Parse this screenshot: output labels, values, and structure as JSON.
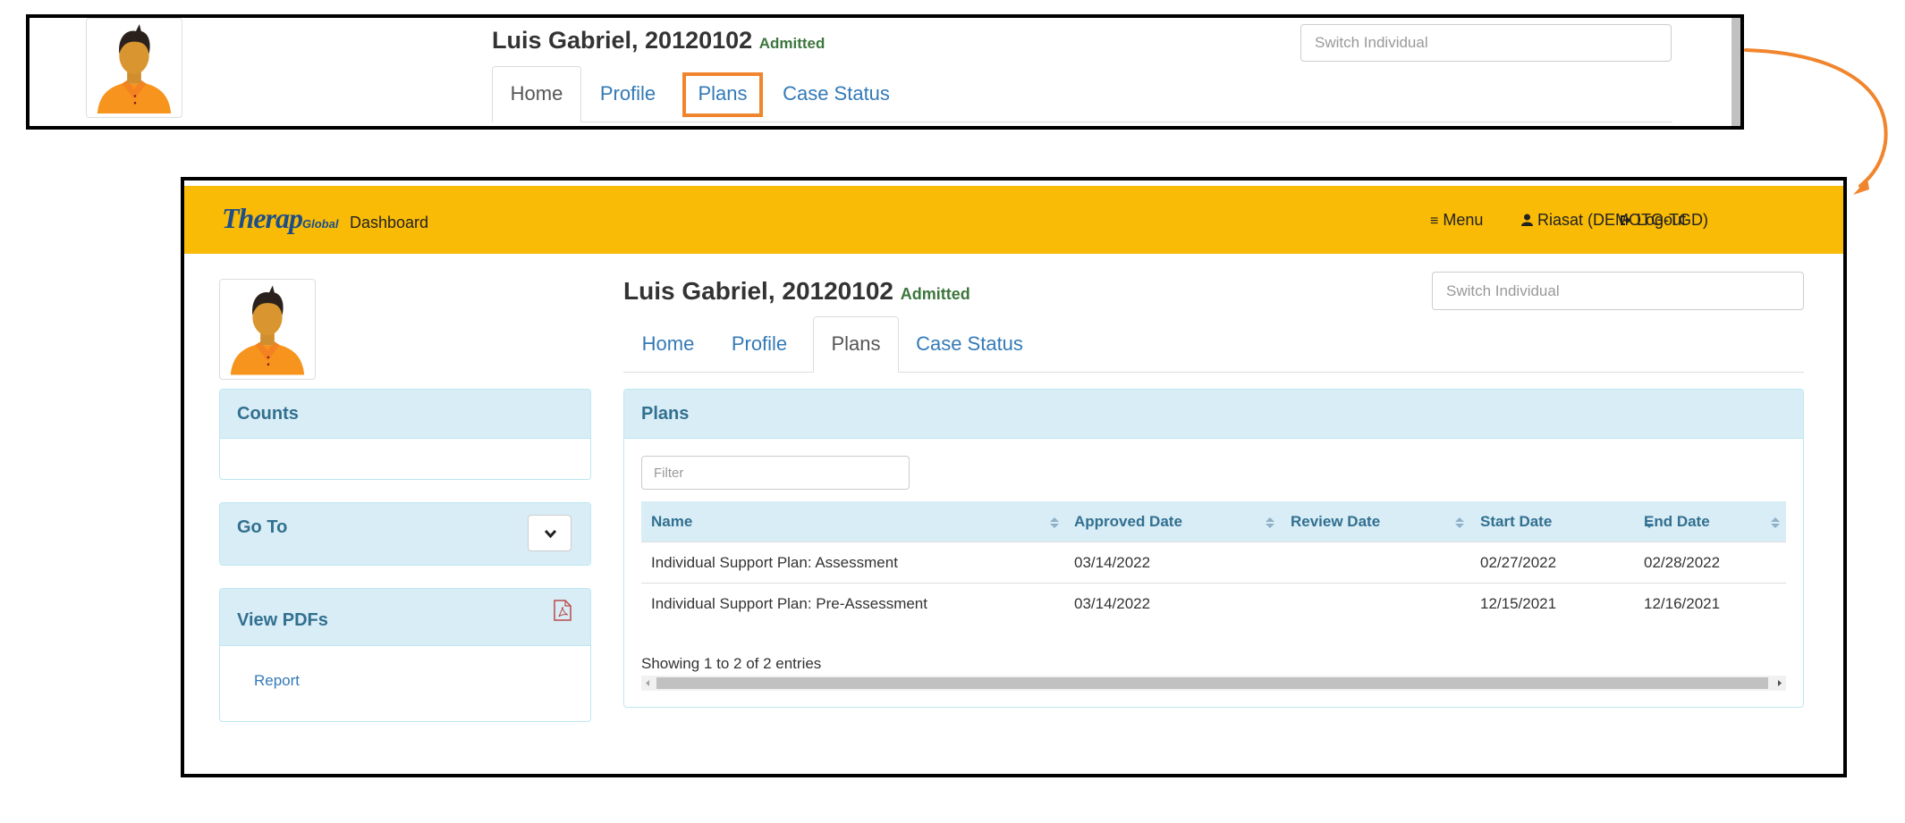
{
  "callout_before": {
    "individual": {
      "name": "Luis Gabriel, 20120102",
      "status": "Admitted"
    },
    "tabs": [
      {
        "label": "Home",
        "active": true
      },
      {
        "label": "Profile",
        "active": false
      },
      {
        "label": "Plans",
        "active": false,
        "highlighted": true
      },
      {
        "label": "Case Status",
        "active": false
      }
    ],
    "switch_individual_placeholder": "Switch Individual",
    "highlight_color": "#f0852d"
  },
  "app": {
    "brand": {
      "name": "Therap",
      "suffix": "Global"
    },
    "header": {
      "dashboard_label": "Dashboard",
      "menu_label": "Menu",
      "user_label": "Riasat (DEMOTG-TGD)",
      "logout_label": "Logout",
      "bar_color": "#f9bb06"
    },
    "individual": {
      "name": "Luis Gabriel, 20120102",
      "status": "Admitted"
    },
    "switch_individual_placeholder": "Switch Individual",
    "tabs": [
      {
        "label": "Home",
        "active": false
      },
      {
        "label": "Profile",
        "active": false
      },
      {
        "label": "Plans",
        "active": true
      },
      {
        "label": "Case Status",
        "active": false
      }
    ],
    "sidebar": {
      "counts": {
        "title": "Counts"
      },
      "goto": {
        "title": "Go To"
      },
      "pdfs": {
        "title": "View PDFs",
        "links": [
          {
            "label": "Report"
          }
        ]
      }
    },
    "plans_panel": {
      "title": "Plans",
      "filter_placeholder": "Filter",
      "columns": [
        {
          "label": "Name",
          "sort": "both"
        },
        {
          "label": "Approved Date",
          "sort": "both"
        },
        {
          "label": "Review Date",
          "sort": "both"
        },
        {
          "label": "Start Date",
          "sort": "desc"
        },
        {
          "label": "End Date",
          "sort": "both"
        }
      ],
      "rows": [
        {
          "name": "Individual Support Plan: Assessment",
          "approved": "03/14/2022",
          "review": "",
          "start": "02/27/2022",
          "end": "02/28/2022"
        },
        {
          "name": "Individual Support Plan: Pre-Assessment",
          "approved": "03/14/2022",
          "review": "",
          "start": "12/15/2021",
          "end": "12/16/2021"
        }
      ],
      "info": "Showing 1 to 2 of 2 entries"
    }
  }
}
